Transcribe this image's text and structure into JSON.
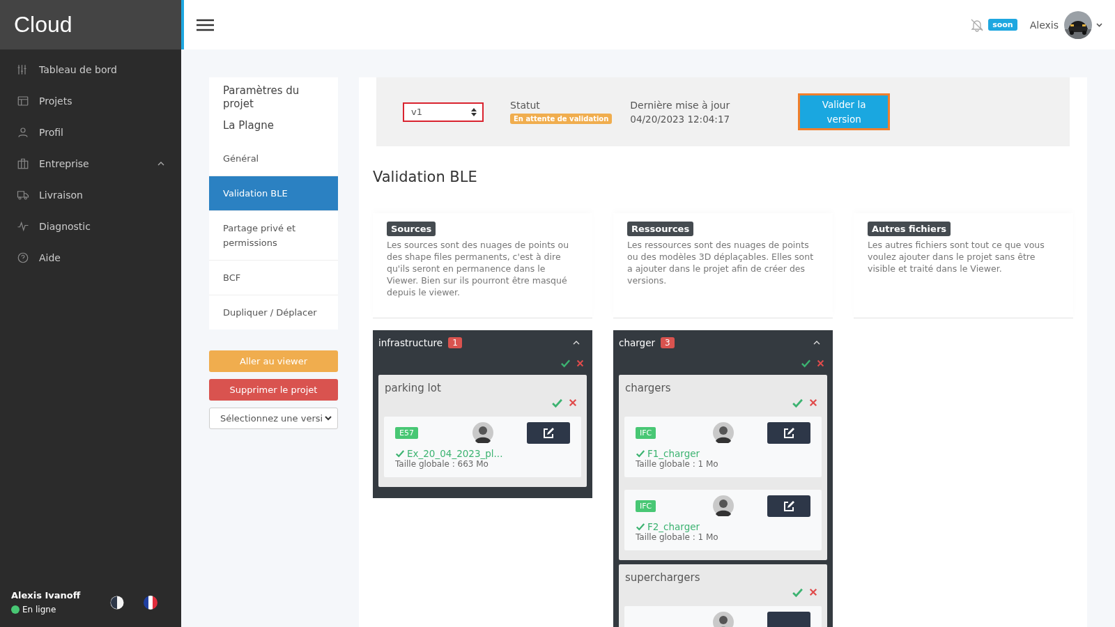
{
  "sidebar": {
    "brand": "Cloud",
    "items": [
      {
        "label": "Tableau de bord",
        "expandable": false
      },
      {
        "label": "Projets",
        "expandable": false
      },
      {
        "label": "Profil",
        "expandable": false
      },
      {
        "label": "Entreprise",
        "expandable": true
      },
      {
        "label": "Livraison",
        "expandable": false
      },
      {
        "label": "Diagnostic",
        "expandable": false
      },
      {
        "label": "Aide",
        "expandable": false
      }
    ],
    "user": {
      "name": "Alexis Ivanoff",
      "status": "En ligne"
    }
  },
  "topbar": {
    "notification_badge": "soon",
    "user_name": "Alexis"
  },
  "project_menu": {
    "title": "Paramètres du projet",
    "project": "La Plagne",
    "items": [
      {
        "label": "Général",
        "selected": false
      },
      {
        "label": "Validation BLE",
        "selected": true
      },
      {
        "label": "Partage privé et permissions",
        "selected": false
      },
      {
        "label": "BCF",
        "selected": false
      },
      {
        "label": "Dupliquer / Déplacer",
        "selected": false
      }
    ],
    "actions": [
      {
        "label": "Aller au viewer",
        "kind": "warning"
      },
      {
        "label": "Supprimer le projet",
        "kind": "danger"
      }
    ],
    "version_select": "Sélectionnez une versi"
  },
  "version_bar": {
    "version": "v1",
    "status_label": "Statut",
    "status": "En attente de validation",
    "updated_label": "Dernière mise à jour",
    "updated": "04/20/2023 12:04:17",
    "button": "Valider la version"
  },
  "page_title": "Validation BLE",
  "columns": [
    {
      "title": "Sources",
      "description": "Les sources sont des nuages de points ou des shape files permanents, c'est à dire qu'ils seront en permanence dans le Viewer. Bien sur ils pourront être masqué depuis le viewer.",
      "groups": [
        {
          "name": "infrastructure",
          "count": "1",
          "expanded": true,
          "categories": [
            {
              "name": "parking lot",
              "files": [
                {
                  "format": "E57",
                  "name": "Ex_20_04_2023_pl...",
                  "size": "Taille globale : 663 Mo",
                  "validated": true
                }
              ]
            }
          ]
        }
      ]
    },
    {
      "title": "Ressources",
      "description": "Les ressources sont des nuages de points ou des modèles 3D déplaçables. Elles sont a ajouter dans le projet afin de créer des versions.",
      "groups": [
        {
          "name": "charger",
          "count": "3",
          "expanded": true,
          "categories": [
            {
              "name": "chargers",
              "files": [
                {
                  "format": "IFC",
                  "name": "F1_charger",
                  "size": "Taille globale : 1 Mo",
                  "validated": true
                },
                {
                  "format": "IFC",
                  "name": "F2_charger",
                  "size": "Taille globale : 1 Mo",
                  "validated": true
                }
              ]
            },
            {
              "name": "superchargers",
              "files": [
                {
                  "kind": "cut"
                }
              ]
            }
          ]
        }
      ]
    },
    {
      "title": "Autres fichiers",
      "description": "Les autres fichiers sont tout ce que vous voulez ajouter dans le projet sans être visible et traité dans le Viewer."
    }
  ]
}
